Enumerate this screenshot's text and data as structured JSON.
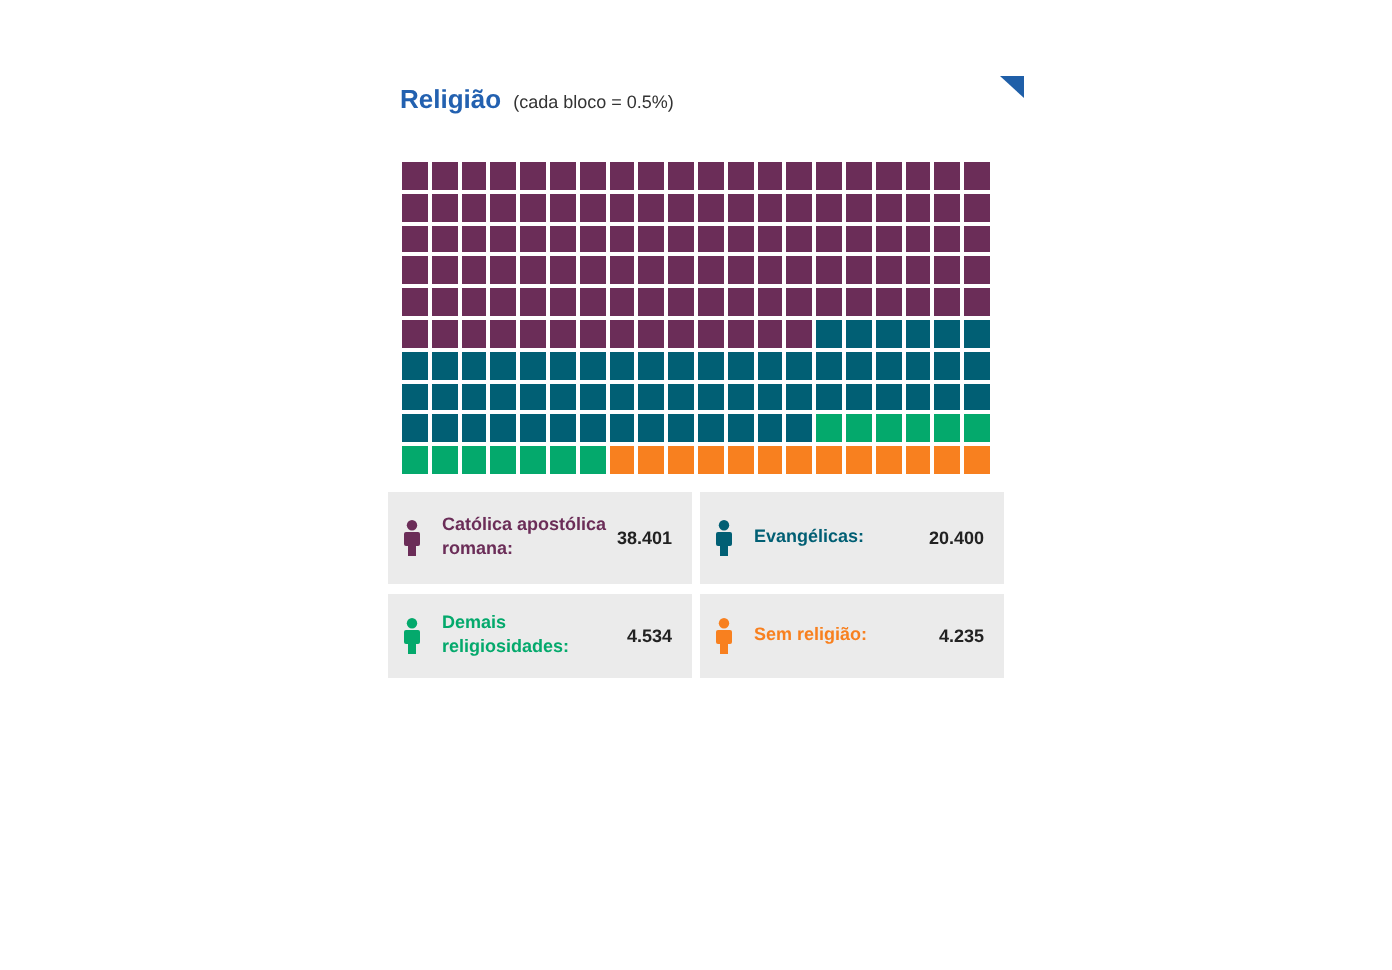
{
  "title": "Religião",
  "subtitle": "(cada bloco = 0.5%)",
  "categories": [
    {
      "label": "Católica apostólica romana:",
      "value": "38.401",
      "color": "#6b2d58"
    },
    {
      "label": "Evangélicas:",
      "value": "20.400",
      "color": "#015f74"
    },
    {
      "label": "Demais religiosidades:",
      "value": "4.534",
      "color": "#04a96c"
    },
    {
      "label": "Sem religião:",
      "value": "4.235",
      "color": "#f8801f"
    }
  ]
}
